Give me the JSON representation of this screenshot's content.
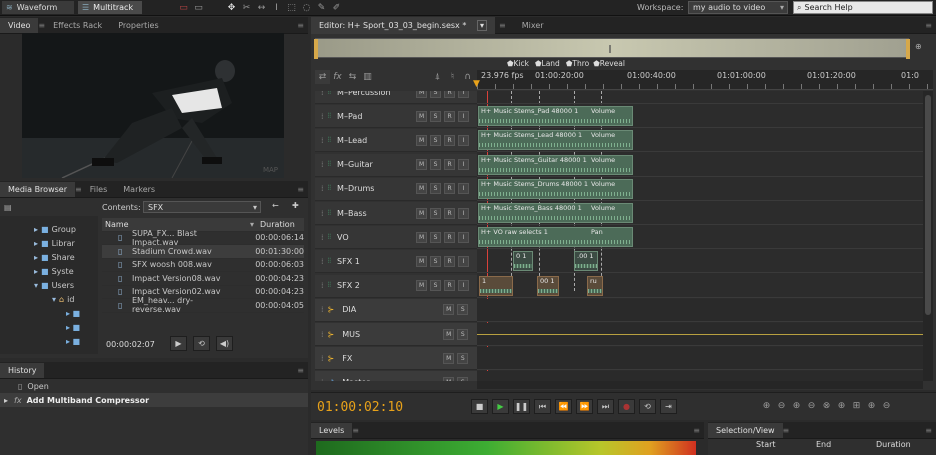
{
  "toolbar": {
    "waveform": "Waveform",
    "multitrack": "Multitrack",
    "workspace_label": "Workspace:",
    "workspace_value": "my audio to video",
    "search_placeholder": "Search Help"
  },
  "left_top_tabs": [
    "Video",
    "Effects Rack",
    "Properties"
  ],
  "video": {
    "watermark": "MAP"
  },
  "media_tabs": [
    "Media Browser",
    "Files",
    "Markers"
  ],
  "media": {
    "contents_label": "Contents:",
    "contents_value": "SFX",
    "tree": [
      "Group",
      "Librar",
      "Share",
      "Syste",
      "Users",
      "id"
    ],
    "col_name": "Name",
    "col_duration": "Duration",
    "files": [
      {
        "name": "SUPA_FX... Blast Impact.wav",
        "dur": "00:00:06:14"
      },
      {
        "name": "Stadium Crowd.wav",
        "dur": "00:01:30:00"
      },
      {
        "name": "SFX woosh 008.wav",
        "dur": "00:00:06:03"
      },
      {
        "name": "Impact Version08.wav",
        "dur": "00:00:04:23"
      },
      {
        "name": "Impact Version02.wav",
        "dur": "00:00:04:23"
      },
      {
        "name": "EM_heav... dry-reverse.wav",
        "dur": "00:00:04:05"
      }
    ],
    "preview_time": "00:00:02:07"
  },
  "history": {
    "title": "History",
    "items": [
      "Open",
      "Add Multiband Compressor"
    ]
  },
  "editor": {
    "tab_label": "Editor: H+ Sport_03_03_begin.sesx *",
    "mixer_label": "Mixer",
    "fps": "23.976 fps",
    "ruler": [
      "00",
      "01:00:20:00",
      "01:00:40:00",
      "01:01:00:00",
      "01:01:20:00",
      "01:0"
    ],
    "markers": [
      "Kick",
      "Land",
      "Thro",
      "Reveal"
    ],
    "timecode": "01:00:02:10"
  },
  "tracks": [
    {
      "name": "M–Percussion",
      "clip": ""
    },
    {
      "name": "M–Pad",
      "clip": "H+ Music Stems_Pad 48000 1",
      "param": "Volume"
    },
    {
      "name": "M–Lead",
      "clip": "H+ Music Stems_Lead 48000 1",
      "param": "Volume"
    },
    {
      "name": "M–Guitar",
      "clip": "H+ Music Stems_Guitar 48000 1",
      "param": "Volume"
    },
    {
      "name": "M–Drums",
      "clip": "H+ Music Stems_Drums 48000 1",
      "param": "Volume"
    },
    {
      "name": "M–Bass",
      "clip": "H+ Music Stems_Bass 48000 1",
      "param": "Volume"
    },
    {
      "name": "VO",
      "clip": "H+ VO raw selects 1",
      "param": "Pan"
    },
    {
      "name": "SFX 1",
      "clip": ""
    },
    {
      "name": "SFX 2",
      "clip": ""
    }
  ],
  "buses": [
    "DIA",
    "MUS",
    "FX",
    "Master"
  ],
  "sfx_clips": {
    "sfx1_a": "0 1",
    "sfx1_b": ".00 1",
    "sfx2_a": "1",
    "sfx2_b": "00 1",
    "sfx2_c": "ru"
  },
  "bottom": {
    "levels": "Levels",
    "selection": "Selection/View",
    "start": "Start",
    "end": "End",
    "duration": "Duration"
  },
  "colors": {
    "timecode": "#e8a21a",
    "playhead": "#d9413a",
    "clip": "#4c6b58"
  }
}
